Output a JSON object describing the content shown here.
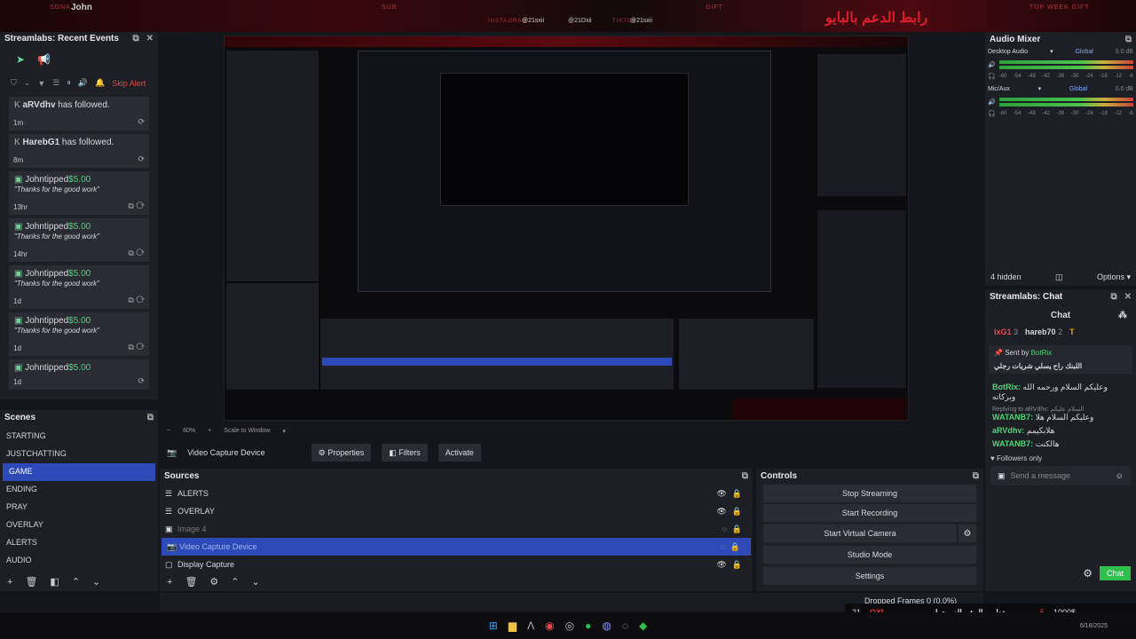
{
  "top_strip": {
    "streamer_label": "SONA",
    "streamer_name": "John",
    "sub_label": "SUB",
    "gift_label": "GIFT",
    "top_gift_label": "TOP WEEK GIFT",
    "social1": "INSTAGRAM",
    "handle1": "@21sxii",
    "handle2": "@21Dxii",
    "social3": "TIKTOK",
    "handle3": "@21sxii",
    "banner_text": "رابط الدعم بالبايو"
  },
  "recent_events": {
    "title": "Streamlabs: Recent Events",
    "skip_alert": "Skip Alert",
    "events": [
      {
        "name": "aRVdhv",
        "text": " has followed.",
        "time": "1m"
      },
      {
        "name": "HarebG1",
        "text": " has followed.",
        "time": "8m"
      },
      {
        "name": "John",
        "text": "tipped",
        "amount": "$5.00",
        "msg": "\"Thanks for the good work\"",
        "time": "13hr"
      },
      {
        "name": "John",
        "text": "tipped",
        "amount": "$5.00",
        "msg": "\"Thanks for the good work\"",
        "time": "14hr"
      },
      {
        "name": "John",
        "text": "tipped",
        "amount": "$5.00",
        "msg": "\"Thanks for the good work\"",
        "time": "1d"
      },
      {
        "name": "John",
        "text": "tipped",
        "amount": "$5.00",
        "msg": "\"Thanks for the good work\"",
        "time": "1d"
      },
      {
        "name": "John",
        "text": "tipped",
        "amount": "$5.00",
        "time": "1d"
      }
    ]
  },
  "scenes": {
    "title": "Scenes",
    "items": [
      "STARTING",
      "JUSTCHATTING",
      "GAME",
      "ENDING",
      "PRAY",
      "OVERLAY",
      "ALERTS",
      "AUDIO"
    ],
    "selected": "GAME"
  },
  "preview_bar": {
    "zoom": "60%",
    "scale": "Scale to Window"
  },
  "source_bar": {
    "selected_source": "Video Capture Device",
    "properties": "Properties",
    "filters": "Filters",
    "activate": "Activate"
  },
  "sources": {
    "title": "Sources",
    "items": [
      "ALERTS",
      "OVERLAY",
      "Image 4",
      "Video Capture Device",
      "Display Capture"
    ]
  },
  "controls": {
    "title": "Controls",
    "buttons": [
      "Stop Streaming",
      "Start Recording",
      "Start Virtual Camera",
      "Studio Mode",
      "Settings"
    ]
  },
  "status": {
    "dropped": "Dropped Frames 0 (0.0%)"
  },
  "audio_mixer": {
    "title": "Audio Mixer",
    "tracks": [
      {
        "name": "Desktop Audio",
        "mode": "Global",
        "db": "0.0 dB"
      },
      {
        "name": "Mic/Aux",
        "mode": "Global",
        "db": "0.0 dB"
      }
    ],
    "scale": [
      "-60",
      "-54",
      "-48",
      "-42",
      "-36",
      "-30",
      "-24",
      "-18",
      "-12",
      "-6"
    ],
    "hidden": "4 hidden",
    "options": "Options"
  },
  "chat": {
    "title": "Streamlabs: Chat",
    "heading": "Chat",
    "top_users": [
      {
        "name": "ixG1",
        "count": "3"
      },
      {
        "name": "hareb70",
        "count": "2"
      },
      {
        "name": "T",
        "count": ""
      }
    ],
    "pinned_by": "Sent by",
    "pinned_user": "BotRix",
    "pinned_text": "اللبنك راح يسلي شريات رجلي",
    "messages": [
      {
        "user": "BotRix:",
        "text": "وعليكم السلام ورحمه الله وبركاته"
      },
      {
        "reply": "Replying to aRVdhv: السلام عليكم",
        "user": "WATANB7:",
        "text": "وعليكم السلام هلا"
      },
      {
        "user": "aRVdhv:",
        "text": "هلابكيمم"
      },
      {
        "user": "WATANB7:",
        "text": "هالكنت"
      }
    ],
    "followers_only": "Followers only",
    "placeholder": "Send a message",
    "send": "Chat"
  },
  "donation": {
    "left": "21",
    "brand": "OXI",
    "title": "تطوير البث والسيت اب",
    "count": "5",
    "goal": "1000$",
    "label": "DONATION GOAL",
    "date": "6/18/2025"
  }
}
